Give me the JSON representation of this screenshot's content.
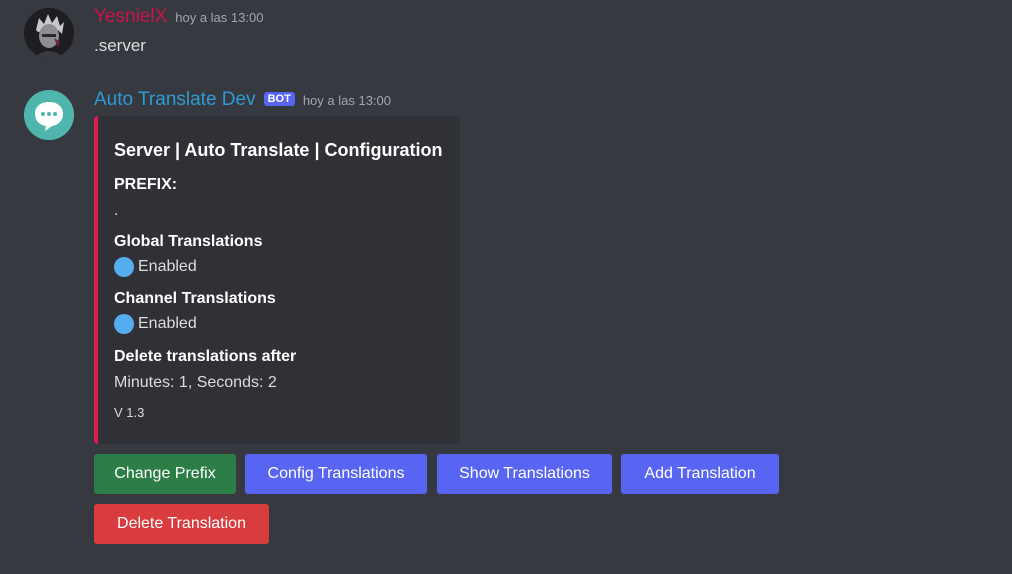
{
  "messages": {
    "user": {
      "name": "YesnielX",
      "timestamp": "hoy a las 13:00",
      "content": ".server"
    },
    "bot": {
      "name": "Auto Translate Dev",
      "tag": "BOT",
      "timestamp": "hoy a las 13:00"
    }
  },
  "embed": {
    "accent_color": "#e01d4d",
    "title": "Server | Auto Translate | Configuration",
    "fields": [
      {
        "name": "PREFIX:",
        "value": "."
      },
      {
        "name": "Global Translations",
        "value": "Enabled",
        "icon": "blue-circle-icon"
      },
      {
        "name": "Channel Translations",
        "value": "Enabled",
        "icon": "blue-circle-icon"
      },
      {
        "name": "Delete translations after",
        "value": "Minutes: 1, Seconds: 2"
      }
    ],
    "footer": "V 1.3"
  },
  "buttons": [
    {
      "label": "Change Prefix",
      "style": "success",
      "color": "#2d7d46"
    },
    {
      "label": "Config Translations",
      "style": "primary",
      "color": "#5865f2"
    },
    {
      "label": "Show Translations",
      "style": "primary",
      "color": "#5865f2"
    },
    {
      "label": "Add Translation",
      "style": "primary",
      "color": "#5865f2"
    },
    {
      "label": "Delete Translation",
      "style": "danger",
      "color": "#d83c3e"
    }
  ]
}
